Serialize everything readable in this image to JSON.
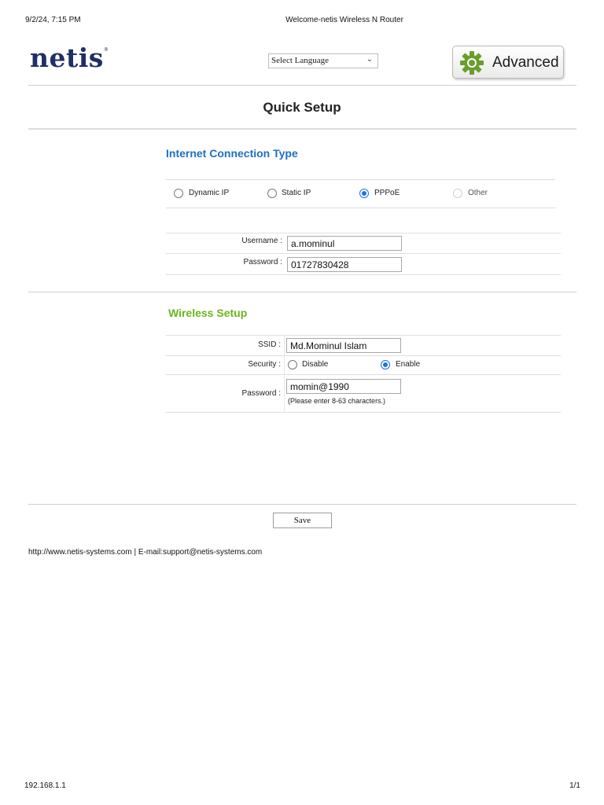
{
  "print_header": {
    "date": "9/2/24, 7:15 PM",
    "title": "Welcome-netis Wireless N Router"
  },
  "header": {
    "logo_text": "netis",
    "language_select": {
      "selected": "Select Language"
    },
    "advanced_button": {
      "label": "Advanced",
      "icon": "gear-icon",
      "icon_color": "#6a9e2c"
    }
  },
  "page_title": "Quick Setup",
  "internet": {
    "title": "Internet Connection Type",
    "title_color": "#1f6fc2",
    "options": [
      {
        "label": "Dynamic IP",
        "selected": false,
        "disabled": false
      },
      {
        "label": "Static IP",
        "selected": false,
        "disabled": false
      },
      {
        "label": "PPPoE",
        "selected": true,
        "disabled": false
      },
      {
        "label": "Other",
        "selected": false,
        "disabled": true
      }
    ],
    "username_label": "Username :",
    "username_value": "a.mominul",
    "password_label": "Password :",
    "password_value": "01727830428"
  },
  "wireless": {
    "title": "Wireless Setup",
    "title_color": "#6ab51e",
    "ssid_label": "SSID :",
    "ssid_value": "Md.Mominul Islam",
    "security_label": "Security :",
    "security_options": [
      {
        "label": "Disable",
        "selected": false
      },
      {
        "label": "Enable",
        "selected": true
      }
    ],
    "password_label": "Password :",
    "password_value": "momin@1990",
    "password_hint": "(Please enter 8-63 characters.)"
  },
  "save_label": "Save",
  "footer": {
    "links": "http://www.netis-systems.com | E-mail:support@netis-systems.com"
  },
  "print_footer": {
    "url": "192.168.1.1",
    "page": "1/1"
  }
}
